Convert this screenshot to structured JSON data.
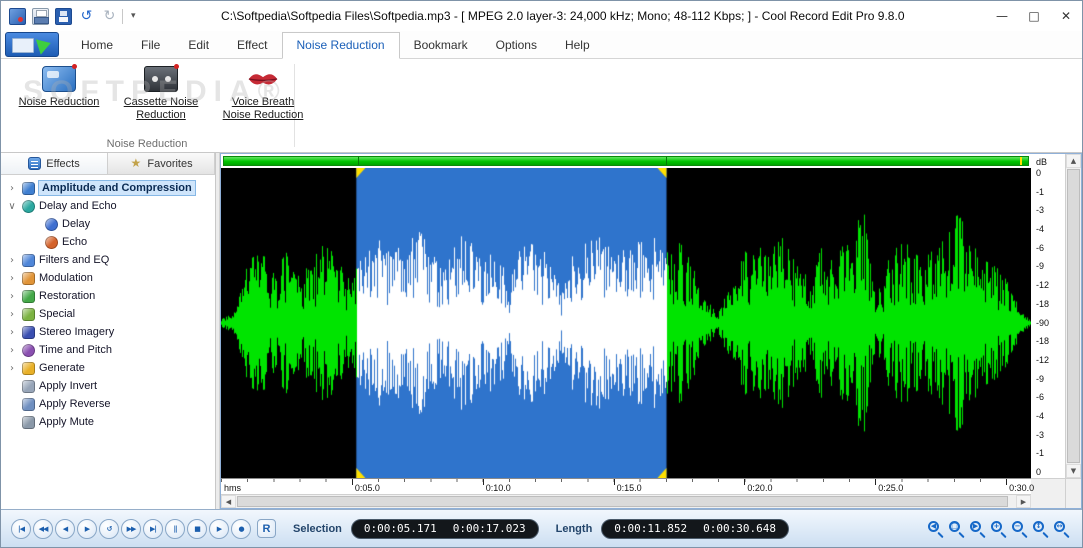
{
  "titlebar": {
    "title": "C:\\Softpedia\\Softpedia Files\\Softpedia.mp3 - [ MPEG 2.0 layer-3: 24,000 kHz; Mono; 48-112 Kbps; ] - Cool Record Edit Pro 9.8.0",
    "quick_access": [
      {
        "name": "record-icon"
      },
      {
        "name": "print-icon"
      },
      {
        "name": "save-icon"
      },
      {
        "name": "undo-icon",
        "glyph": "↺"
      },
      {
        "name": "redo-icon",
        "glyph": "↻"
      }
    ],
    "dropdown_glyph": "▾",
    "minimize_glyph": "—",
    "maximize_glyph": "□",
    "close_glyph": "✕"
  },
  "ribbon": {
    "tabs": [
      {
        "label": "Home"
      },
      {
        "label": "File"
      },
      {
        "label": "Edit"
      },
      {
        "label": "Effect"
      },
      {
        "label": "Noise Reduction",
        "active": true
      },
      {
        "label": "Bookmark"
      },
      {
        "label": "Options"
      },
      {
        "label": "Help"
      }
    ],
    "buttons": [
      {
        "label": "Noise Reduction",
        "icon": "noise-reduction-icon"
      },
      {
        "label": "Cassette Noise Reduction",
        "icon": "cassette-noise-reduction-icon"
      },
      {
        "label": "Voice Breath Noise Reduction",
        "icon": "voice-breath-noise-reduction-icon"
      }
    ],
    "group_title": "Noise Reduction",
    "watermark": "SOFTPEDIA®"
  },
  "sidebar": {
    "tabs": [
      {
        "label": "Effects",
        "icon": "effects-icon",
        "active": true
      },
      {
        "label": "Favorites",
        "icon": "star-icon",
        "glyph": "★",
        "active": false
      }
    ],
    "tree": [
      {
        "label": "Amplitude and Compression",
        "chevron": "›",
        "selected": true,
        "icon": "amplitude-icon",
        "color": "#3f7fd0",
        "level": 0
      },
      {
        "label": "Delay and Echo",
        "chevron": "∨",
        "expanded": true,
        "icon": "delay-echo-icon",
        "color": "#2ba8a0",
        "shape": "round",
        "level": 0
      },
      {
        "label": "Delay",
        "icon": "delay-icon",
        "color": "#3f6fd0",
        "shape": "round",
        "level": 1
      },
      {
        "label": "Echo",
        "icon": "echo-icon",
        "color": "#d4622a",
        "shape": "round",
        "level": 1
      },
      {
        "label": "Filters and EQ",
        "chevron": "›",
        "icon": "filters-icon",
        "color": "#4f86d8",
        "level": 0
      },
      {
        "label": "Modulation",
        "chevron": "›",
        "icon": "modulation-icon",
        "color": "#e09438",
        "level": 0
      },
      {
        "label": "Restoration",
        "chevron": "›",
        "icon": "restoration-icon",
        "color": "#44a848",
        "level": 0
      },
      {
        "label": "Special",
        "chevron": "›",
        "icon": "special-icon",
        "color": "#7cb342",
        "level": 0
      },
      {
        "label": "Stereo Imagery",
        "chevron": "›",
        "icon": "stereo-imagery-icon",
        "color": "#3a4fb0",
        "level": 0
      },
      {
        "label": "Time and Pitch",
        "chevron": "›",
        "icon": "time-pitch-icon",
        "color": "#8a4fb0",
        "shape": "round",
        "level": 0
      },
      {
        "label": "Generate",
        "chevron": "›",
        "icon": "generate-icon",
        "color": "#e8b028",
        "level": 0
      },
      {
        "label": "Apply Invert",
        "icon": "apply-invert-icon",
        "color": "#97a5b8",
        "level": 0
      },
      {
        "label": "Apply Reverse",
        "icon": "apply-reverse-icon",
        "color": "#6f8fc0",
        "level": 0
      },
      {
        "label": "Apply Mute",
        "icon": "apply-mute-icon",
        "color": "#8a98a8",
        "level": 0
      }
    ]
  },
  "scrollbar": {
    "up": "▲",
    "down": "▼",
    "left": "◀",
    "right": "▶"
  },
  "waveform": {
    "db_axis_title": "dB",
    "db_labels": [
      "0",
      "-1",
      "-3",
      "-4",
      "-6",
      "-9",
      "-12",
      "-18",
      "-90",
      "-18",
      "-12",
      "-9",
      "-6",
      "-4",
      "-3",
      "-1",
      "0"
    ],
    "timeline_unit": "hms",
    "timeline_ticks": [
      {
        "t": 5,
        "label": "0:05.0"
      },
      {
        "t": 10,
        "label": "0:10.0"
      },
      {
        "t": 15,
        "label": "0:15.0"
      },
      {
        "t": 20,
        "label": "0:20.0"
      },
      {
        "t": 25,
        "label": "0:25.0"
      },
      {
        "t": 30,
        "label": "0:30.0"
      }
    ],
    "view_start_s": 0,
    "view_end_s": 30.95,
    "selection_start_s": 5.171,
    "selection_end_s": 17.023,
    "file_end_s": 30.648,
    "envelope_step_s": 0.5,
    "envelope": [
      0.04,
      0.08,
      0.42,
      0.5,
      0.34,
      0.55,
      0.3,
      0.46,
      0.56,
      0.4,
      0.32,
      0.5,
      0.6,
      0.46,
      0.55,
      0.64,
      0.5,
      0.36,
      0.6,
      0.55,
      0.42,
      0.5,
      0.3,
      0.55,
      0.6,
      0.46,
      0.22,
      0.5,
      0.56,
      0.6,
      0.46,
      0.5,
      0.55,
      0.6,
      0.5,
      0.56,
      0.4,
      0.16,
      0.08,
      0.3,
      0.5,
      0.56,
      0.5,
      0.6,
      0.46,
      0.3,
      0.55,
      0.5,
      0.55,
      0.82,
      0.15,
      0.45,
      0.55,
      0.5,
      0.46,
      0.55,
      0.85,
      0.6,
      0.45,
      0.4,
      0.3,
      0.1,
      0.0
    ],
    "colors": {
      "background": "#000000",
      "wave": "#00e400",
      "wave_selected": "#ffffff",
      "selection": "#2f74cc",
      "center_line": "#e8e8e8",
      "marker": "#ffe000"
    }
  },
  "transport": {
    "buttons": [
      {
        "name": "skip-to-start-button",
        "glyph": "|◀"
      },
      {
        "name": "rewind-button",
        "glyph": "◀◀"
      },
      {
        "name": "play-backward-button",
        "glyph": "◀"
      },
      {
        "name": "play-button",
        "glyph": "▶"
      },
      {
        "name": "loop-play-button",
        "glyph": "↺"
      },
      {
        "name": "fast-forward-button",
        "glyph": "▶▶"
      },
      {
        "name": "skip-to-end-button",
        "glyph": "▶|"
      },
      {
        "name": "pause-button",
        "glyph": "||"
      },
      {
        "name": "stop-button",
        "glyph": "■"
      },
      {
        "name": "play-selection-button",
        "glyph": "▶"
      },
      {
        "name": "record-button",
        "glyph": "●"
      }
    ],
    "record_label": "R"
  },
  "status": {
    "selection_label": "Selection",
    "selection_start": "0:00:05.171",
    "selection_end": "0:00:17.023",
    "length_label": "Length",
    "selection_length": "0:00:11.852",
    "total_length": "0:00:30.648"
  },
  "zoom": {
    "buttons": [
      {
        "name": "zoom-to-selection-start-button",
        "glyph": "◀"
      },
      {
        "name": "zoom-selection-button",
        "glyph": "□"
      },
      {
        "name": "zoom-to-selection-end-button",
        "glyph": "▶"
      },
      {
        "name": "zoom-in-button",
        "glyph": "+"
      },
      {
        "name": "zoom-out-button",
        "glyph": "−"
      },
      {
        "name": "zoom-vertical-button",
        "glyph": "↕"
      },
      {
        "name": "zoom-full-button",
        "glyph": "↔"
      }
    ]
  }
}
